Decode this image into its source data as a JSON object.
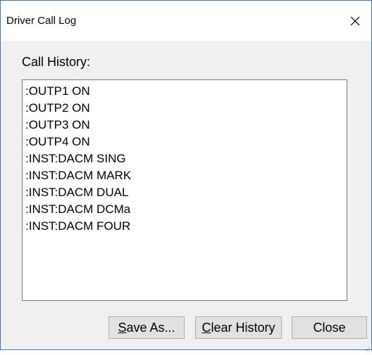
{
  "window": {
    "title": "Driver Call Log"
  },
  "icons": {
    "close": "close-icon",
    "grip": "size-grip-icon"
  },
  "main": {
    "group_label": "Call History:",
    "history": [
      ":OUTP1 ON",
      ":OUTP2 ON",
      ":OUTP3 ON",
      ":OUTP4 ON",
      ":INST:DACM SING",
      ":INST:DACM MARK",
      ":INST:DACM DUAL",
      ":INST:DACM DCMa",
      ":INST:DACM FOUR"
    ]
  },
  "buttons": {
    "save_as": {
      "mnemonic": "S",
      "rest": "ave As..."
    },
    "clear_history": {
      "mnemonic": "C",
      "rest": "lear History"
    },
    "close": "Close"
  },
  "colors": {
    "window_border": "#4a6fb5",
    "dialog_bg": "#f0f0f0",
    "button_bg": "#e1e1e1",
    "button_border": "#adadad",
    "list_border": "#7a7a7a"
  }
}
